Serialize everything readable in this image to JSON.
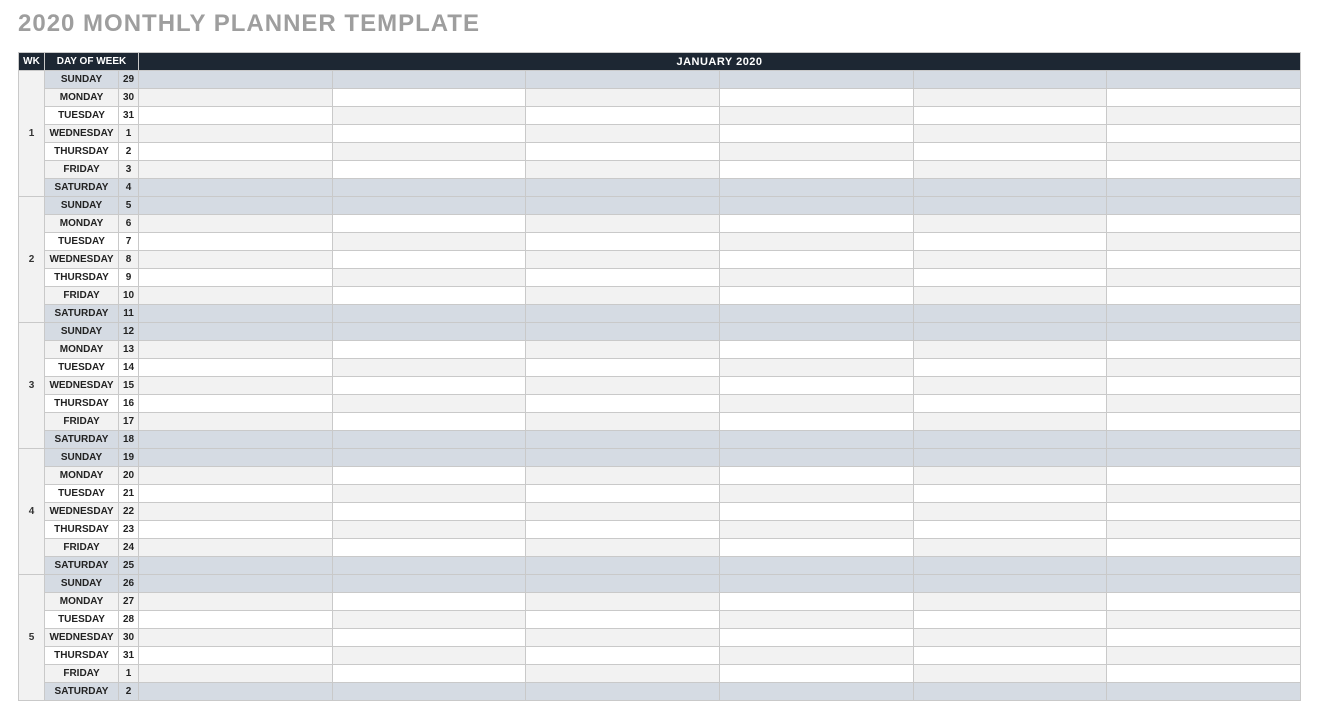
{
  "title": "2020 MONTHLY PLANNER TEMPLATE",
  "headers": {
    "wk": "WK",
    "day_of_week": "DAY OF WEEK",
    "month": "JANUARY 2020"
  },
  "entry_columns": 6,
  "weeks": [
    {
      "wk": "1",
      "days": [
        {
          "name": "SUNDAY",
          "date": "29",
          "weekend": true
        },
        {
          "name": "MONDAY",
          "date": "30",
          "weekend": false
        },
        {
          "name": "TUESDAY",
          "date": "31",
          "weekend": false
        },
        {
          "name": "WEDNESDAY",
          "date": "1",
          "weekend": false
        },
        {
          "name": "THURSDAY",
          "date": "2",
          "weekend": false
        },
        {
          "name": "FRIDAY",
          "date": "3",
          "weekend": false
        },
        {
          "name": "SATURDAY",
          "date": "4",
          "weekend": true
        }
      ]
    },
    {
      "wk": "2",
      "days": [
        {
          "name": "SUNDAY",
          "date": "5",
          "weekend": true
        },
        {
          "name": "MONDAY",
          "date": "6",
          "weekend": false
        },
        {
          "name": "TUESDAY",
          "date": "7",
          "weekend": false
        },
        {
          "name": "WEDNESDAY",
          "date": "8",
          "weekend": false
        },
        {
          "name": "THURSDAY",
          "date": "9",
          "weekend": false
        },
        {
          "name": "FRIDAY",
          "date": "10",
          "weekend": false
        },
        {
          "name": "SATURDAY",
          "date": "11",
          "weekend": true
        }
      ]
    },
    {
      "wk": "3",
      "days": [
        {
          "name": "SUNDAY",
          "date": "12",
          "weekend": true
        },
        {
          "name": "MONDAY",
          "date": "13",
          "weekend": false
        },
        {
          "name": "TUESDAY",
          "date": "14",
          "weekend": false
        },
        {
          "name": "WEDNESDAY",
          "date": "15",
          "weekend": false
        },
        {
          "name": "THURSDAY",
          "date": "16",
          "weekend": false
        },
        {
          "name": "FRIDAY",
          "date": "17",
          "weekend": false
        },
        {
          "name": "SATURDAY",
          "date": "18",
          "weekend": true
        }
      ]
    },
    {
      "wk": "4",
      "days": [
        {
          "name": "SUNDAY",
          "date": "19",
          "weekend": true
        },
        {
          "name": "MONDAY",
          "date": "20",
          "weekend": false
        },
        {
          "name": "TUESDAY",
          "date": "21",
          "weekend": false
        },
        {
          "name": "WEDNESDAY",
          "date": "22",
          "weekend": false
        },
        {
          "name": "THURSDAY",
          "date": "23",
          "weekend": false
        },
        {
          "name": "FRIDAY",
          "date": "24",
          "weekend": false
        },
        {
          "name": "SATURDAY",
          "date": "25",
          "weekend": true
        }
      ]
    },
    {
      "wk": "5",
      "days": [
        {
          "name": "SUNDAY",
          "date": "26",
          "weekend": true
        },
        {
          "name": "MONDAY",
          "date": "27",
          "weekend": false
        },
        {
          "name": "TUESDAY",
          "date": "28",
          "weekend": false
        },
        {
          "name": "WEDNESDAY",
          "date": "30",
          "weekend": false
        },
        {
          "name": "THURSDAY",
          "date": "31",
          "weekend": false
        },
        {
          "name": "FRIDAY",
          "date": "1",
          "weekend": false
        },
        {
          "name": "SATURDAY",
          "date": "2",
          "weekend": true
        }
      ]
    }
  ]
}
